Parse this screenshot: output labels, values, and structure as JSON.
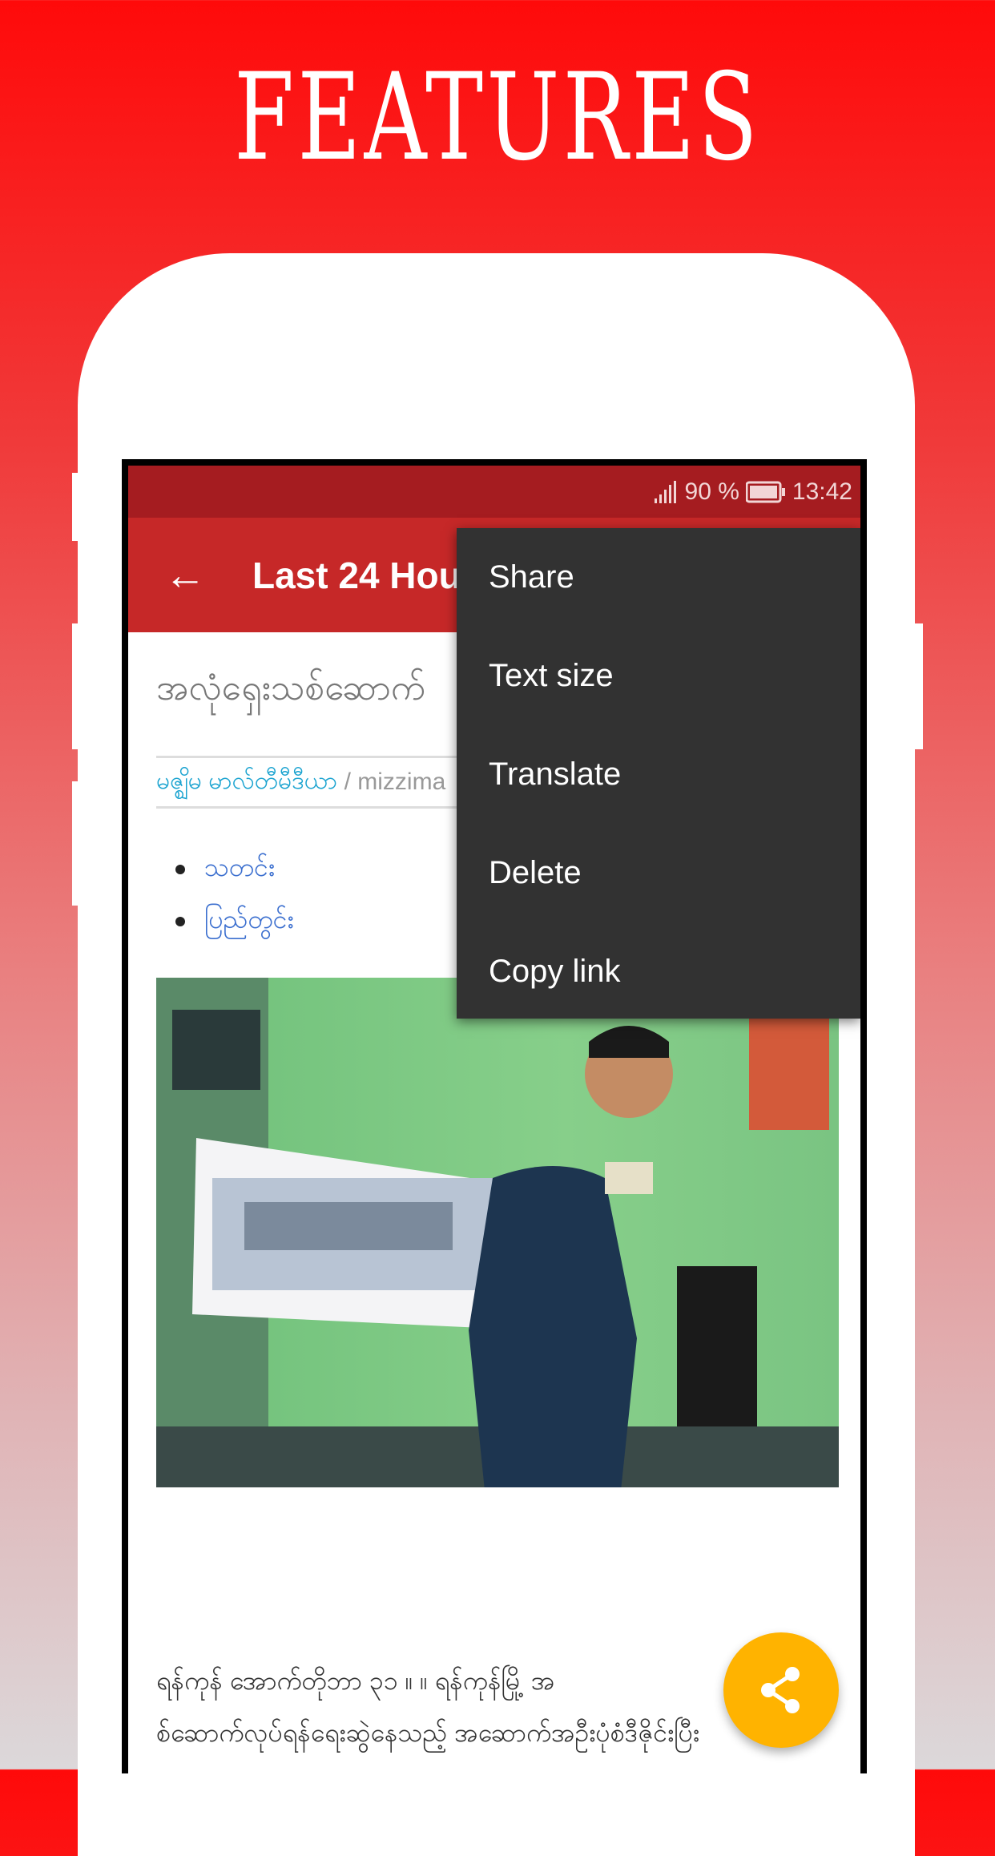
{
  "banner": {
    "title": "FEATURES"
  },
  "status_bar": {
    "battery": "90 %",
    "time": "13:42"
  },
  "app_bar": {
    "title": "Last 24 Hours"
  },
  "menu": {
    "items": [
      "Share",
      "Text size",
      "Translate",
      "Delete",
      "Copy link"
    ]
  },
  "article": {
    "headline": "အလုံရှေးသစ်ဆောက်",
    "source_name": "မဇ္ဈိမ မာလ်တီမီဒီယာ",
    "source_sep": " / ",
    "source_site": "mizzima",
    "tags": [
      "သတင်း",
      "ပြည်တွင်း"
    ],
    "body_lines": [
      "ရန်ကုန် အောက်တိုဘာ ၃၁ ။              ။ ရန်ကုန်မြို့ အ",
      "စ်ဆောက်လုပ်ရန်ရေးဆွဲနေသည့်   အဆောက်အဦးပုံစံဒီဇိုင်းပြီး"
    ]
  },
  "colors": {
    "status_bar": "#a51c20",
    "app_bar": "#c62828",
    "menu": "#323232",
    "fab": "#ffb300",
    "link": "#1aa3d0"
  },
  "fab": {
    "icon": "share-icon"
  }
}
